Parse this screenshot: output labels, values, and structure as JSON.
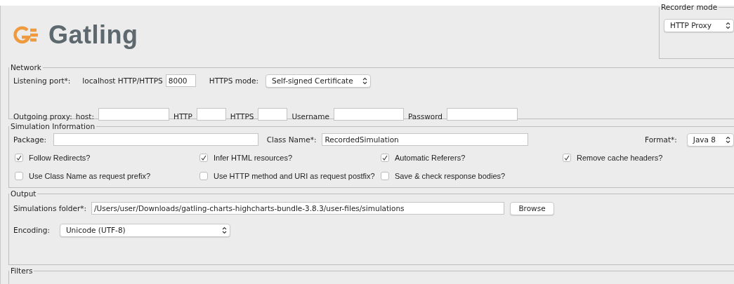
{
  "logo": {
    "name": "Gatling"
  },
  "recorder_mode": {
    "title": "Recorder mode",
    "mode": "HTTP Proxy"
  },
  "network": {
    "title": "Network",
    "listening_port_label": "Listening port*:",
    "local_label": "localhost HTTP/HTTPS",
    "port": "8000",
    "https_mode_label": "HTTPS mode:",
    "https_mode": "Self-signed Certificate",
    "proxy_label": "Outgoing proxy:",
    "host_label": "host:",
    "http_label": "HTTP",
    "https_label": "HTTPS",
    "username_label": "Username",
    "password_label": "Password"
  },
  "simulation": {
    "title": "Simulation Information",
    "package_label": "Package:",
    "class_name_label": "Class Name*:",
    "class_name": "RecordedSimulation",
    "format_label": "Format*:",
    "format": "Java 8",
    "options": [
      {
        "label": "Follow Redirects?",
        "checked": true
      },
      {
        "label": "Infer HTML resources?",
        "checked": true
      },
      {
        "label": "Automatic Referers?",
        "checked": true
      },
      {
        "label": "Remove cache headers?",
        "checked": true
      },
      {
        "label": "Use Class Name as request prefix?",
        "checked": false
      },
      {
        "label": "Use HTTP method and URI as request postfix?",
        "checked": false
      },
      {
        "label": "Save & check response bodies?",
        "checked": false
      }
    ]
  },
  "output": {
    "title": "Output",
    "folder_label": "Simulations folder*:",
    "folder": "/Users/user/Downloads/gatling-charts-highcharts-bundle-3.8.3/user-files/simulations",
    "browse": "Browse",
    "encoding_label": "Encoding:",
    "encoding": "Unicode (UTF-8)"
  },
  "filters": {
    "title": "Filters"
  }
}
